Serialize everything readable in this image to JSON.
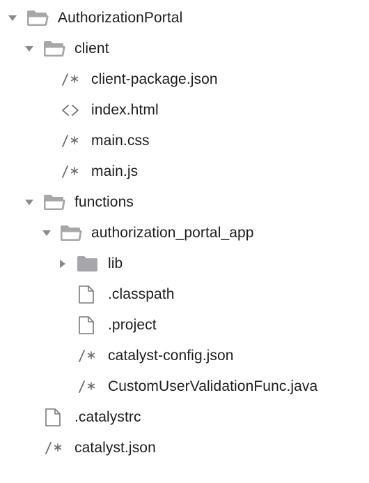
{
  "tree": {
    "root": {
      "label": "AuthorizationPortal",
      "expanded": true,
      "icon": "folder-open-icon"
    },
    "client": {
      "label": "client",
      "expanded": true,
      "icon": "folder-open-icon"
    },
    "client_files": [
      {
        "label": "client-package.json",
        "icon": "comment-glyph-icon",
        "glyph": "/*"
      },
      {
        "label": "index.html",
        "icon": "code-brackets-icon",
        "glyph": "<>"
      },
      {
        "label": "main.css",
        "icon": "comment-glyph-icon",
        "glyph": "/*"
      },
      {
        "label": "main.js",
        "icon": "comment-glyph-icon",
        "glyph": "/*"
      }
    ],
    "functions": {
      "label": "functions",
      "expanded": true,
      "icon": "folder-open-icon"
    },
    "app": {
      "label": "authorization_portal_app",
      "expanded": true,
      "icon": "folder-open-icon"
    },
    "lib": {
      "label": "lib",
      "expanded": false,
      "icon": "folder-closed-icon"
    },
    "app_files": [
      {
        "label": ".classpath",
        "icon": "file-icon"
      },
      {
        "label": ".project",
        "icon": "file-icon"
      },
      {
        "label": "catalyst-config.json",
        "icon": "comment-glyph-icon",
        "glyph": "/*"
      },
      {
        "label": "CustomUserValidationFunc.java",
        "icon": "comment-glyph-icon",
        "glyph": "/*"
      }
    ],
    "root_files": [
      {
        "label": ".catalystrc",
        "icon": "file-icon"
      },
      {
        "label": "catalyst.json",
        "icon": "comment-glyph-icon",
        "glyph": "/*"
      }
    ]
  }
}
